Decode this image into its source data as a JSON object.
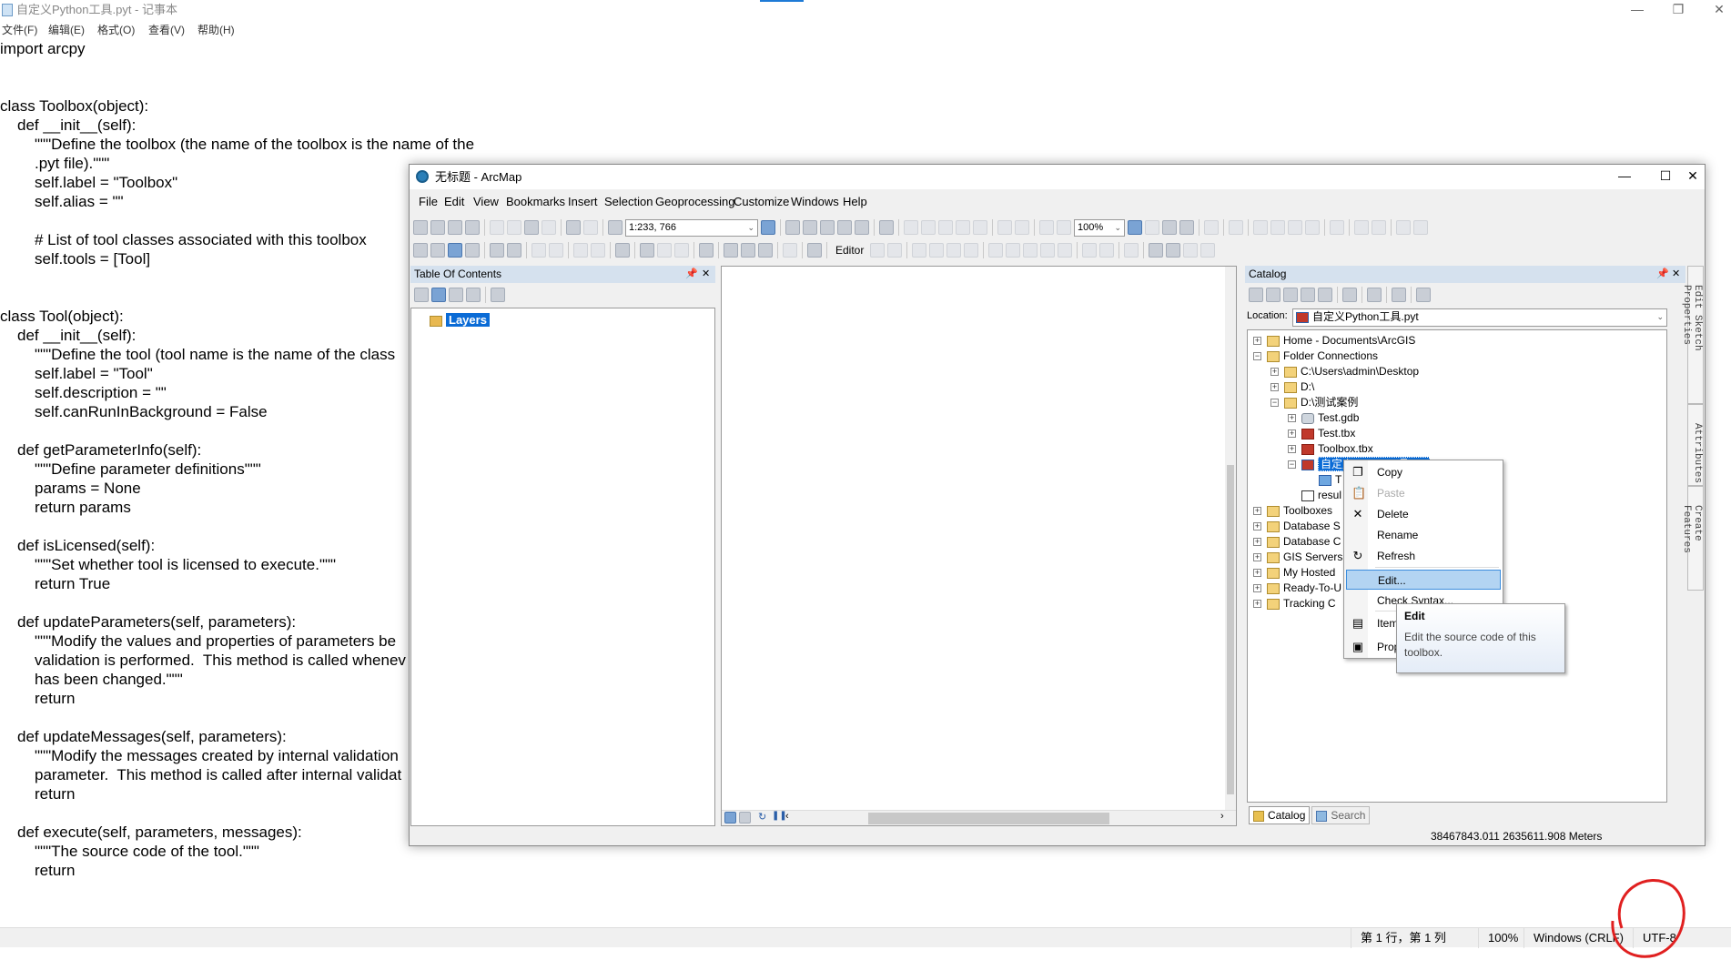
{
  "notepad": {
    "title": "自定义Python工具.pyt - 记事本",
    "menu": [
      "文件(F)",
      "编辑(E)",
      "格式(O)",
      "查看(V)",
      "帮助(H)"
    ],
    "window_controls": [
      "minimize-icon",
      "restore-icon",
      "close-icon"
    ],
    "code_lines": [
      {
        "indent": 0,
        "text": "import arcpy"
      },
      {
        "indent": 0,
        "text": ""
      },
      {
        "indent": 0,
        "text": ""
      },
      {
        "indent": 0,
        "text": "class Toolbox(object):"
      },
      {
        "indent": 1,
        "text": "def __init__(self):"
      },
      {
        "indent": 2,
        "text": "\"\"\"Define the toolbox (the name of the toolbox is the name of the"
      },
      {
        "indent": 2,
        "text": ".pyt file).\"\"\""
      },
      {
        "indent": 2,
        "text": "self.label = \"Toolbox\""
      },
      {
        "indent": 2,
        "text": "self.alias = \"\""
      },
      {
        "indent": 0,
        "text": ""
      },
      {
        "indent": 2,
        "text": "# List of tool classes associated with this toolbox"
      },
      {
        "indent": 2,
        "text": "self.tools = [Tool]"
      },
      {
        "indent": 0,
        "text": ""
      },
      {
        "indent": 0,
        "text": ""
      },
      {
        "indent": 0,
        "text": "class Tool(object):"
      },
      {
        "indent": 1,
        "text": "def __init__(self):"
      },
      {
        "indent": 2,
        "text": "\"\"\"Define the tool (tool name is the name of the class"
      },
      {
        "indent": 2,
        "text": "self.label = \"Tool\""
      },
      {
        "indent": 2,
        "text": "self.description = \"\""
      },
      {
        "indent": 2,
        "text": "self.canRunInBackground = False"
      },
      {
        "indent": 0,
        "text": ""
      },
      {
        "indent": 1,
        "text": "def getParameterInfo(self):"
      },
      {
        "indent": 2,
        "text": "\"\"\"Define parameter definitions\"\"\""
      },
      {
        "indent": 2,
        "text": "params = None"
      },
      {
        "indent": 2,
        "text": "return params"
      },
      {
        "indent": 0,
        "text": ""
      },
      {
        "indent": 1,
        "text": "def isLicensed(self):"
      },
      {
        "indent": 2,
        "text": "\"\"\"Set whether tool is licensed to execute.\"\"\""
      },
      {
        "indent": 2,
        "text": "return True"
      },
      {
        "indent": 0,
        "text": ""
      },
      {
        "indent": 1,
        "text": "def updateParameters(self, parameters):"
      },
      {
        "indent": 2,
        "text": "\"\"\"Modify the values and properties of parameters be"
      },
      {
        "indent": 2,
        "text": "validation is performed.  This method is called whenev"
      },
      {
        "indent": 2,
        "text": "has been changed.\"\"\""
      },
      {
        "indent": 2,
        "text": "return"
      },
      {
        "indent": 0,
        "text": ""
      },
      {
        "indent": 1,
        "text": "def updateMessages(self, parameters):"
      },
      {
        "indent": 2,
        "text": "\"\"\"Modify the messages created by internal validation"
      },
      {
        "indent": 2,
        "text": "parameter.  This method is called after internal validat"
      },
      {
        "indent": 2,
        "text": "return"
      },
      {
        "indent": 0,
        "text": ""
      },
      {
        "indent": 1,
        "text": "def execute(self, parameters, messages):"
      },
      {
        "indent": 2,
        "text": "\"\"\"The source code of the tool.\"\"\""
      },
      {
        "indent": 2,
        "text": "return"
      }
    ],
    "status": {
      "position": "第 1 行，第 1 列",
      "zoom": "100%",
      "line_ending": "Windows (CRLF)",
      "encoding": "UTF-8"
    },
    "annotation_color": "#e02020"
  },
  "arcmap": {
    "title": "无标题 - ArcMap",
    "menu": [
      "File",
      "Edit",
      "View",
      "Bookmarks",
      "Insert",
      "Selection",
      "Geoprocessing",
      "Customize",
      "Windows",
      "Help"
    ],
    "scale": "1:233, 766",
    "layout_zoom": "100%",
    "editor_label": "Editor",
    "toc": {
      "title": "Table Of Contents",
      "root": "Layers"
    },
    "catalog": {
      "title": "Catalog",
      "location_label": "Location:",
      "location_value": "自定义Python工具.pyt",
      "tree": [
        {
          "level": 0,
          "exp": "+",
          "icon": "home-folder",
          "label": "Home - Documents\\ArcGIS"
        },
        {
          "level": 0,
          "exp": "-",
          "icon": "folder-connections",
          "label": "Folder Connections"
        },
        {
          "level": 1,
          "exp": "+",
          "icon": "folder",
          "label": "C:\\Users\\admin\\Desktop"
        },
        {
          "level": 1,
          "exp": "+",
          "icon": "folder",
          "label": "D:\\"
        },
        {
          "level": 1,
          "exp": "-",
          "icon": "folder",
          "label": "D:\\测试案例"
        },
        {
          "level": 2,
          "exp": "+",
          "icon": "gdb",
          "label": "Test.gdb"
        },
        {
          "level": 2,
          "exp": "+",
          "icon": "tbx",
          "label": "Test.tbx"
        },
        {
          "level": 2,
          "exp": "+",
          "icon": "tbx",
          "label": "Toolbox.tbx"
        },
        {
          "level": 2,
          "exp": "-",
          "icon": "py",
          "label": "自定义Python工具.pyt",
          "selected": true
        },
        {
          "level": 3,
          "exp": "",
          "icon": "tool",
          "label": "T"
        },
        {
          "level": 2,
          "exp": "",
          "icon": "xml",
          "label": "resul"
        },
        {
          "level": 0,
          "exp": "+",
          "icon": "folder",
          "label": "Toolboxes"
        },
        {
          "level": 0,
          "exp": "+",
          "icon": "folder",
          "label": "Database S"
        },
        {
          "level": 0,
          "exp": "+",
          "icon": "folder",
          "label": "Database C"
        },
        {
          "level": 0,
          "exp": "+",
          "icon": "folder",
          "label": "GIS Servers"
        },
        {
          "level": 0,
          "exp": "+",
          "icon": "folder",
          "label": "My Hosted"
        },
        {
          "level": 0,
          "exp": "+",
          "icon": "folder",
          "label": "Ready-To-U"
        },
        {
          "level": 0,
          "exp": "+",
          "icon": "folder",
          "label": "Tracking C"
        }
      ],
      "tabs": [
        "Catalog",
        "Search"
      ]
    },
    "context_menu": [
      {
        "label": "Copy",
        "icon": "copy-icon",
        "glyph": "❐"
      },
      {
        "label": "Paste",
        "icon": "paste-icon",
        "glyph": "📋",
        "disabled": true
      },
      {
        "label": "Delete",
        "icon": "delete-icon",
        "glyph": "✕"
      },
      {
        "label": "Rename",
        "icon": "",
        "glyph": ""
      },
      {
        "label": "Refresh",
        "icon": "refresh-icon",
        "glyph": "↻"
      },
      {
        "label": "Edit...",
        "icon": "",
        "glyph": "",
        "highlighted": true
      },
      {
        "label": "Check Syntax...",
        "icon": "",
        "glyph": ""
      },
      {
        "label": "Item Description...",
        "icon": "item-description-icon",
        "glyph": "▤"
      },
      {
        "label": "Properties...",
        "icon": "properties-icon",
        "glyph": "▣"
      }
    ],
    "tooltip": {
      "title": "Edit",
      "body": "Edit the source code of this toolbox."
    },
    "side_tabs": [
      "Edit Sketch Properties",
      "Attributes",
      "Create Features"
    ],
    "status_coords": "38467843.011  2635611.908 Meters"
  }
}
